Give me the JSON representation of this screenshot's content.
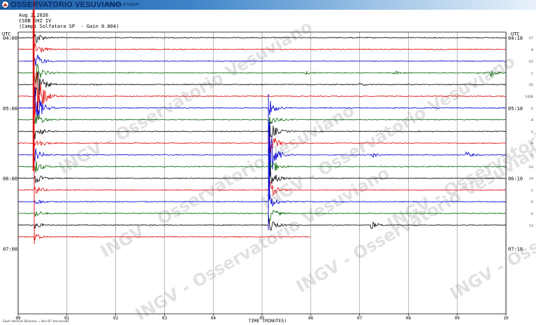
{
  "header": {
    "brand": "OSSERVATORIO VESUVIANO",
    "subtitle": "Sezione di Napoli",
    "logo_icon": "ov-logo-icon"
  },
  "station_info": {
    "date": "Aug 2,2026",
    "channel": "CSOB EHZ IV",
    "site_gain": "(Campi Solfatara SP  - Gain 0.004)"
  },
  "watermark": "INGV - Osservatorio Vesuviano",
  "footnote": "Each Vertical Division =  9e+07 microvolts",
  "colors": {
    "trace_cycle": [
      "#000000",
      "#e00000",
      "#0000d0",
      "#006600"
    ],
    "grid": "#9a9a9a",
    "watermark": "#c8c8c8",
    "header_dark": "#1f5fa8"
  },
  "chart_data": {
    "type": "line",
    "title": "",
    "xlabel": "TIME (MINUTES)",
    "ylabel_left": "UTC",
    "ylabel_right": "UTC",
    "x_ticks": [
      "00",
      "01",
      "02",
      "03",
      "04",
      "05",
      "06",
      "07",
      "08",
      "09",
      "10"
    ],
    "xlim": [
      0,
      10
    ],
    "left_time_labels": [
      {
        "row": 0,
        "label": "04:00"
      },
      {
        "row": 6,
        "label": "05:00"
      },
      {
        "row": 12,
        "label": "06:00"
      },
      {
        "row": 18,
        "label": "07:00"
      }
    ],
    "right_time_labels": [
      {
        "row": 0,
        "label": "04:10"
      },
      {
        "row": 6,
        "label": "05:10"
      },
      {
        "row": 12,
        "label": "06:10"
      },
      {
        "row": 18,
        "label": "07:10"
      }
    ],
    "right_values": [
      "-17",
      "8",
      "-12",
      "1",
      "-25",
      "1426",
      "-1",
      "-4",
      "5",
      "-9",
      "-7",
      "-12",
      "14",
      "1",
      "-5",
      "-2",
      "12"
    ],
    "grid": true,
    "series": [
      {
        "row": 0,
        "color": "#000000",
        "end_minute": 10,
        "events": [
          {
            "minute": 0.35,
            "amplitude": 10
          }
        ]
      },
      {
        "row": 1,
        "color": "#e00000",
        "end_minute": 10,
        "events": [
          {
            "minute": 0.35,
            "amplitude": 12
          }
        ]
      },
      {
        "row": 2,
        "color": "#0000d0",
        "end_minute": 10,
        "events": [
          {
            "minute": 0.35,
            "amplitude": 14
          }
        ]
      },
      {
        "row": 3,
        "color": "#006600",
        "end_minute": 10,
        "events": [
          {
            "minute": 0.35,
            "amplitude": 18
          },
          {
            "minute": 5.9,
            "amplitude": 2
          },
          {
            "minute": 7.7,
            "amplitude": 3
          },
          {
            "minute": 9.7,
            "amplitude": 5
          }
        ]
      },
      {
        "row": 4,
        "color": "#000000",
        "end_minute": 10,
        "events": [
          {
            "minute": 0.35,
            "amplitude": 30
          },
          {
            "minute": 1.5,
            "amplitude": 1.5
          },
          {
            "minute": 7.0,
            "amplitude": 1.5
          }
        ]
      },
      {
        "row": 5,
        "color": "#e00000",
        "end_minute": 10,
        "events": [
          {
            "minute": 0.35,
            "amplitude": 60
          }
        ]
      },
      {
        "row": 6,
        "color": "#0000d0",
        "end_minute": 10,
        "events": [
          {
            "minute": 0.35,
            "amplitude": 30
          },
          {
            "minute": 5.15,
            "amplitude": 12
          }
        ]
      },
      {
        "row": 7,
        "color": "#006600",
        "end_minute": 10,
        "events": [
          {
            "minute": 0.35,
            "amplitude": 14
          },
          {
            "minute": 5.15,
            "amplitude": 12
          }
        ]
      },
      {
        "row": 8,
        "color": "#000000",
        "end_minute": 10,
        "events": [
          {
            "minute": 0.35,
            "amplitude": 12
          },
          {
            "minute": 5.15,
            "amplitude": 16
          }
        ]
      },
      {
        "row": 9,
        "color": "#e00000",
        "end_minute": 10,
        "events": [
          {
            "minute": 0.35,
            "amplitude": 12
          },
          {
            "minute": 5.15,
            "amplitude": 20
          }
        ]
      },
      {
        "row": 10,
        "color": "#0000d0",
        "end_minute": 10,
        "events": [
          {
            "minute": 0.35,
            "amplitude": 10
          },
          {
            "minute": 5.15,
            "amplitude": 40
          },
          {
            "minute": 7.25,
            "amplitude": 4
          },
          {
            "minute": 9.2,
            "amplitude": 4
          }
        ]
      },
      {
        "row": 11,
        "color": "#006600",
        "end_minute": 10,
        "events": [
          {
            "minute": 0.35,
            "amplitude": 10
          },
          {
            "minute": 5.15,
            "amplitude": 18
          }
        ]
      },
      {
        "row": 12,
        "color": "#000000",
        "end_minute": 10,
        "events": [
          {
            "minute": 0.35,
            "amplitude": 8
          },
          {
            "minute": 5.15,
            "amplitude": 16
          }
        ]
      },
      {
        "row": 13,
        "color": "#e00000",
        "end_minute": 10,
        "events": [
          {
            "minute": 0.35,
            "amplitude": 8
          },
          {
            "minute": 5.15,
            "amplitude": 14
          }
        ]
      },
      {
        "row": 14,
        "color": "#0000d0",
        "end_minute": 10,
        "events": [
          {
            "minute": 0.35,
            "amplitude": 6
          },
          {
            "minute": 5.15,
            "amplitude": 14
          }
        ]
      },
      {
        "row": 15,
        "color": "#006600",
        "end_minute": 10,
        "events": [
          {
            "minute": 0.35,
            "amplitude": 6
          },
          {
            "minute": 5.15,
            "amplitude": 12
          }
        ]
      },
      {
        "row": 16,
        "color": "#000000",
        "end_minute": 10,
        "events": [
          {
            "minute": 0.35,
            "amplitude": 5
          },
          {
            "minute": 5.15,
            "amplitude": 12
          },
          {
            "minute": 7.25,
            "amplitude": 5
          }
        ]
      },
      {
        "row": 17,
        "color": "#e00000",
        "end_minute": 6,
        "events": [
          {
            "minute": 0.35,
            "amplitude": 5
          }
        ]
      }
    ]
  }
}
